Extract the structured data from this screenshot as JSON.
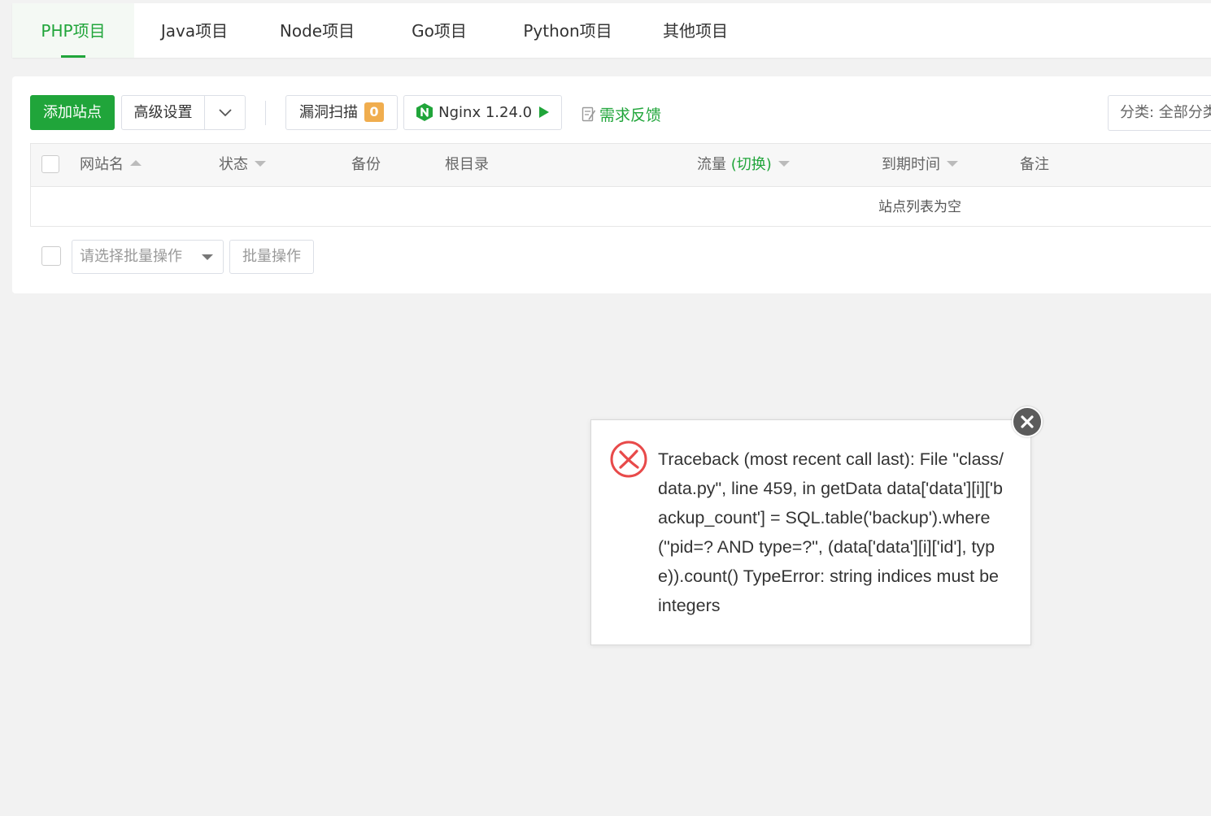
{
  "tabs": [
    {
      "label": "PHP项目",
      "active": true
    },
    {
      "label": "Java项目",
      "active": false
    },
    {
      "label": "Node项目",
      "active": false
    },
    {
      "label": "Go项目",
      "active": false
    },
    {
      "label": "Python项目",
      "active": false
    },
    {
      "label": "其他项目",
      "active": false
    }
  ],
  "toolbar": {
    "add_site": "添加站点",
    "advanced": "高级设置",
    "dropdown_icon": "chevron-down-icon",
    "scan_label": "漏洞扫描",
    "scan_count": "0",
    "nginx_label": "Nginx 1.24.0",
    "feedback": "需求反馈",
    "category": "分类: 全部分类"
  },
  "table": {
    "headers": {
      "name": "网站名",
      "status": "状态",
      "backup": "备份",
      "root": "根目录",
      "traffic": "流量",
      "traffic_switch": "(切换)",
      "expire": "到期时间",
      "remark": "备注"
    },
    "empty_text": "站点列表为空"
  },
  "batch": {
    "select_placeholder": "请选择批量操作",
    "button": "批量操作"
  },
  "dialog": {
    "message": "Traceback (most recent call last): File \"class/data.py\", line 459, in getData data['data'][i]['backup_count'] = SQL.table('backup').where(\"pid=? AND type=?\", (data['data'][i]['id'], type)).count() TypeError: string indices must be integers"
  },
  "colors": {
    "accent": "#20a53a",
    "badge": "#f0ad4e",
    "error": "#e84a4a",
    "page_bg": "#f2f2f2"
  }
}
